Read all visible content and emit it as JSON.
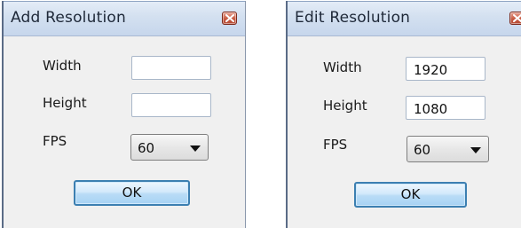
{
  "add_dialog": {
    "title": "Add Resolution",
    "width_label": "Width",
    "width_value": "",
    "height_label": "Height",
    "height_value": "",
    "fps_label": "FPS",
    "fps_selected": "60",
    "ok_label": "OK"
  },
  "edit_dialog": {
    "title": "Edit Resolution",
    "width_label": "Width",
    "width_value": "1920",
    "height_label": "Height",
    "height_value": "1080",
    "fps_label": "FPS",
    "fps_selected": "60",
    "ok_label": "OK"
  },
  "icons": {
    "close": "close-icon",
    "dropdown": "chevron-down-icon"
  },
  "colors": {
    "titlebar": "#d3e0f0",
    "close_button": "#c85a42",
    "ok_button": "#b9dcf6",
    "ok_border": "#3c7fb1",
    "dialog_bg": "#f0f0f0"
  }
}
